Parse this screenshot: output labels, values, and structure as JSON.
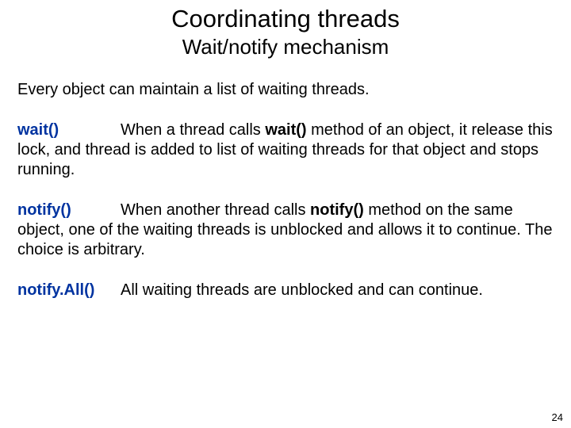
{
  "title": "Coordinating threads",
  "subtitle": "Wait/notify mechanism",
  "intro": "Every object can maintain a list of waiting threads.",
  "items": [
    {
      "term": "wait()",
      "pre": "When a thread calls ",
      "bold": "wait()",
      "post": " method of an object, it release this lock, and thread is added to list of waiting threads for that object and stops running."
    },
    {
      "term": "notify()",
      "pre": "When another thread calls ",
      "bold": "notify()",
      "post": " method on the same object, one of the waiting threads is unblocked and allows it to continue.  The choice is arbitrary."
    },
    {
      "term": "notify.All()",
      "pre": "",
      "bold": "",
      "post": "All waiting threads are unblocked and can continue."
    }
  ],
  "page_number": "24"
}
